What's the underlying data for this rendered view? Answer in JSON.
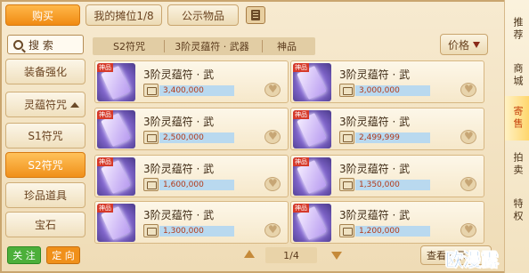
{
  "top_tabs": {
    "buy": "购买",
    "my_stall": "我的摊位1/8",
    "public_items": "公示物品"
  },
  "search": {
    "label": "搜  索"
  },
  "categories": [
    {
      "label": "装备强化"
    },
    {
      "label": "灵蕴符咒"
    },
    {
      "label": "S1符咒"
    },
    {
      "label": "S2符咒"
    },
    {
      "label": "珍品道具"
    },
    {
      "label": "宝石"
    }
  ],
  "bottom_buttons": {
    "follow": "关 注",
    "target": "定 向"
  },
  "filters": [
    "S2符咒",
    "3阶灵蕴符 · 武器",
    "神品"
  ],
  "sort": {
    "label": "价格"
  },
  "item_tag": "神品",
  "items": [
    {
      "name": "3阶灵蕴符 · 武",
      "price": "3,400,000"
    },
    {
      "name": "3阶灵蕴符 · 武",
      "price": "3,000,000"
    },
    {
      "name": "3阶灵蕴符 · 武",
      "price": "2,500,000"
    },
    {
      "name": "3阶灵蕴符 · 武",
      "price": "2,499,999"
    },
    {
      "name": "3阶灵蕴符 · 武",
      "price": "1,600,000"
    },
    {
      "name": "3阶灵蕴符 · 武",
      "price": "1,350,000"
    },
    {
      "name": "3阶灵蕴符 · 武",
      "price": "1,300,000"
    },
    {
      "name": "3阶灵蕴符 · 武",
      "price": "1,200,000"
    }
  ],
  "pagination": {
    "text": "1/4"
  },
  "public_button": "查看公示",
  "right_nav": [
    {
      "label": "推荐"
    },
    {
      "label": "商城"
    },
    {
      "label": "寄售"
    },
    {
      "label": "拍卖"
    },
    {
      "label": "特权"
    }
  ],
  "watermark": "欧漫露",
  "colors": {
    "active_tab": "#f08a12",
    "price_text": "#b23a1a",
    "price_bg": "#b9d9ef",
    "follow_btn": "#4caf3a",
    "target_btn": "#f0901a"
  }
}
